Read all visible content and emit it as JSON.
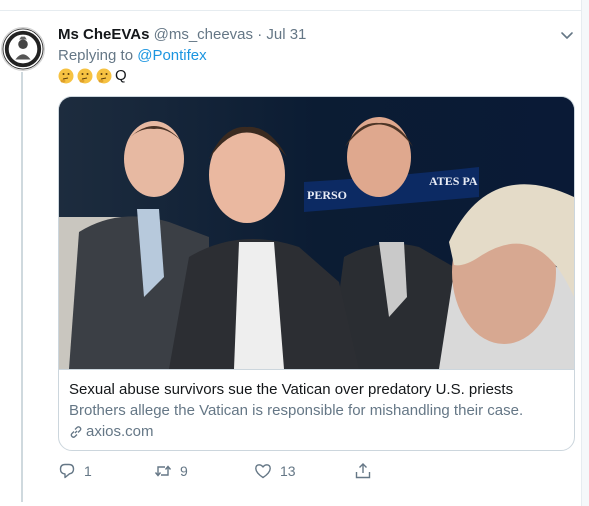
{
  "tweet": {
    "display_name": "Ms CheEVAs",
    "handle": "@ms_cheevas",
    "separator": "·",
    "date": "Jul 31",
    "replying_prefix": "Replying to",
    "replying_to": "@Pontifex",
    "emojis": [
      "thinking-face-emoji",
      "thinking-face-emoji",
      "thinking-face-emoji"
    ],
    "text_suffix": "Q"
  },
  "card": {
    "title": "Sexual abuse survivors sue the Vatican over predatory U.S. priests",
    "description": "Brothers allege the Vatican is responsible for mishandling their case.",
    "domain": "axios.com",
    "image_sign_text_left": "PERSO",
    "image_sign_text_right": "ATES PA"
  },
  "actions": {
    "reply_count": "1",
    "retweet_count": "9",
    "like_count": "13"
  },
  "colors": {
    "link": "#1b95e0",
    "muted": "#657786",
    "text": "#14171a",
    "border": "#ccd6dd"
  }
}
